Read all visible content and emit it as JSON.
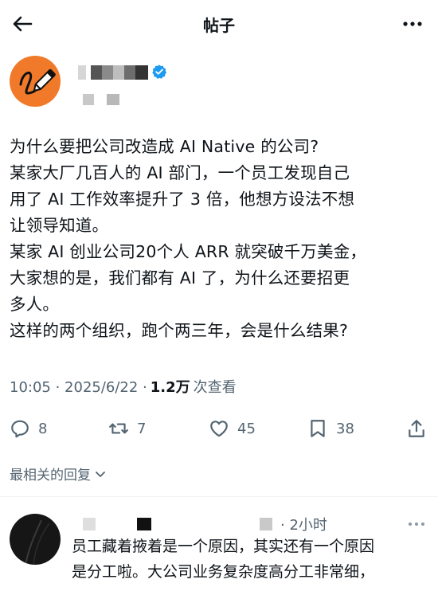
{
  "header": {
    "title": "帖子"
  },
  "post": {
    "lines": [
      "为什么要把公司改造成 AI Native 的公司?",
      "某家大厂几百人的 AI 部门，一个员工发现自己",
      "用了 AI 工作效率提升了 3 倍，他想方设法不想",
      "让领导知道。",
      "某家 AI 创业公司20个人 ARR 就突破千万美金，",
      "大家想的是，我们都有 AI 了，为什么还要招更",
      "多人。",
      "这样的两个组织，跑个两三年，会是什么结果?"
    ],
    "time": "10:05 · 2025/6/22 ·",
    "views": "1.2万",
    "views_suffix": "次查看"
  },
  "actions": {
    "reply_count": "8",
    "retweet_count": "7",
    "like_count": "45",
    "bookmark_count": "38"
  },
  "icons": [
    "back-arrow-icon",
    "more-icon",
    "verified-icon",
    "reply-icon",
    "retweet-icon",
    "like-icon",
    "bookmark-icon",
    "share-icon",
    "chevron-down-icon"
  ],
  "colors": {
    "verified": "#1d9bf0",
    "avatar": "#f07a2a",
    "muted": "#536471"
  },
  "replies": {
    "sort_label": "最相关的回复",
    "items": [
      {
        "time": "· 2小时",
        "lines": [
          "员工藏着掖着是一个原因，其实还有一个原因",
          "是分工啦。大公司业务复杂度高分工非常细，"
        ]
      }
    ]
  }
}
